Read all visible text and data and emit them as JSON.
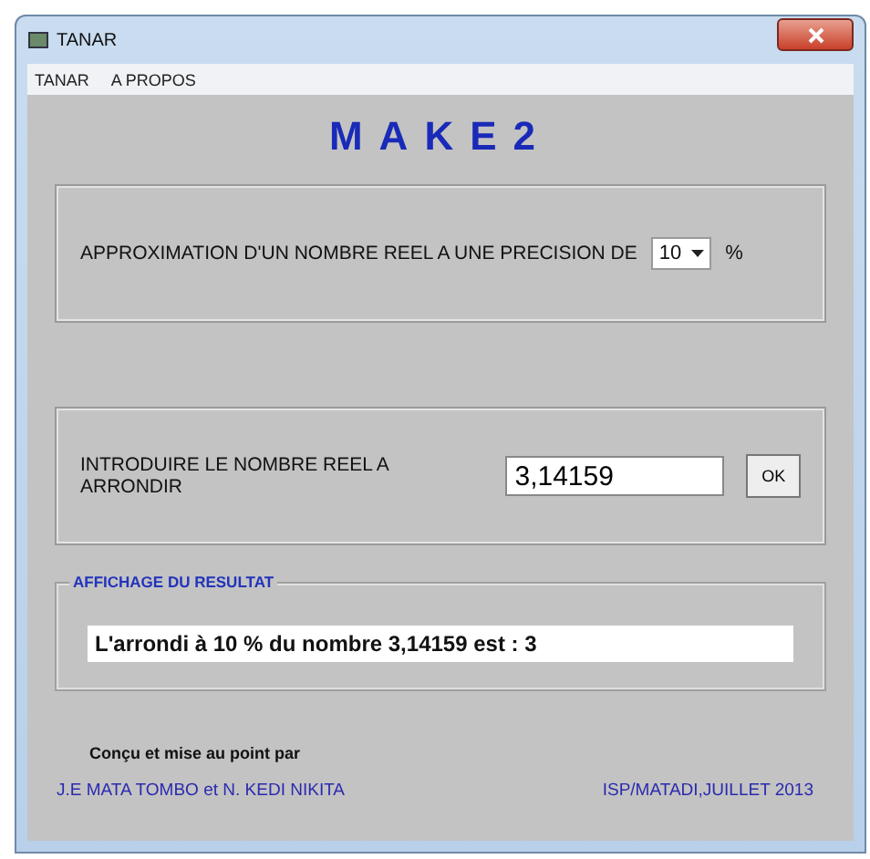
{
  "window": {
    "title": "TANAR"
  },
  "menu": [
    "TANAR",
    "A PROPOS"
  ],
  "heading": "MAKE2",
  "precision": {
    "label": "APPROXIMATION D'UN NOMBRE REEL A UNE PRECISION DE",
    "value": "10",
    "unit": "%"
  },
  "input": {
    "label": "INTRODUIRE LE NOMBRE REEL A ARRONDIR",
    "value": "3,14159",
    "button": "OK"
  },
  "result": {
    "group_title": "AFFICHAGE DU RESULTAT",
    "text": "L'arrondi à  10 %  du nombre  3,14159  est :  3"
  },
  "footer": {
    "credit": "Conçu et mise au point par",
    "authors": "J.E MATA TOMBO et N. KEDI NIKITA",
    "place": "ISP/MATADI,JUILLET 2013"
  }
}
